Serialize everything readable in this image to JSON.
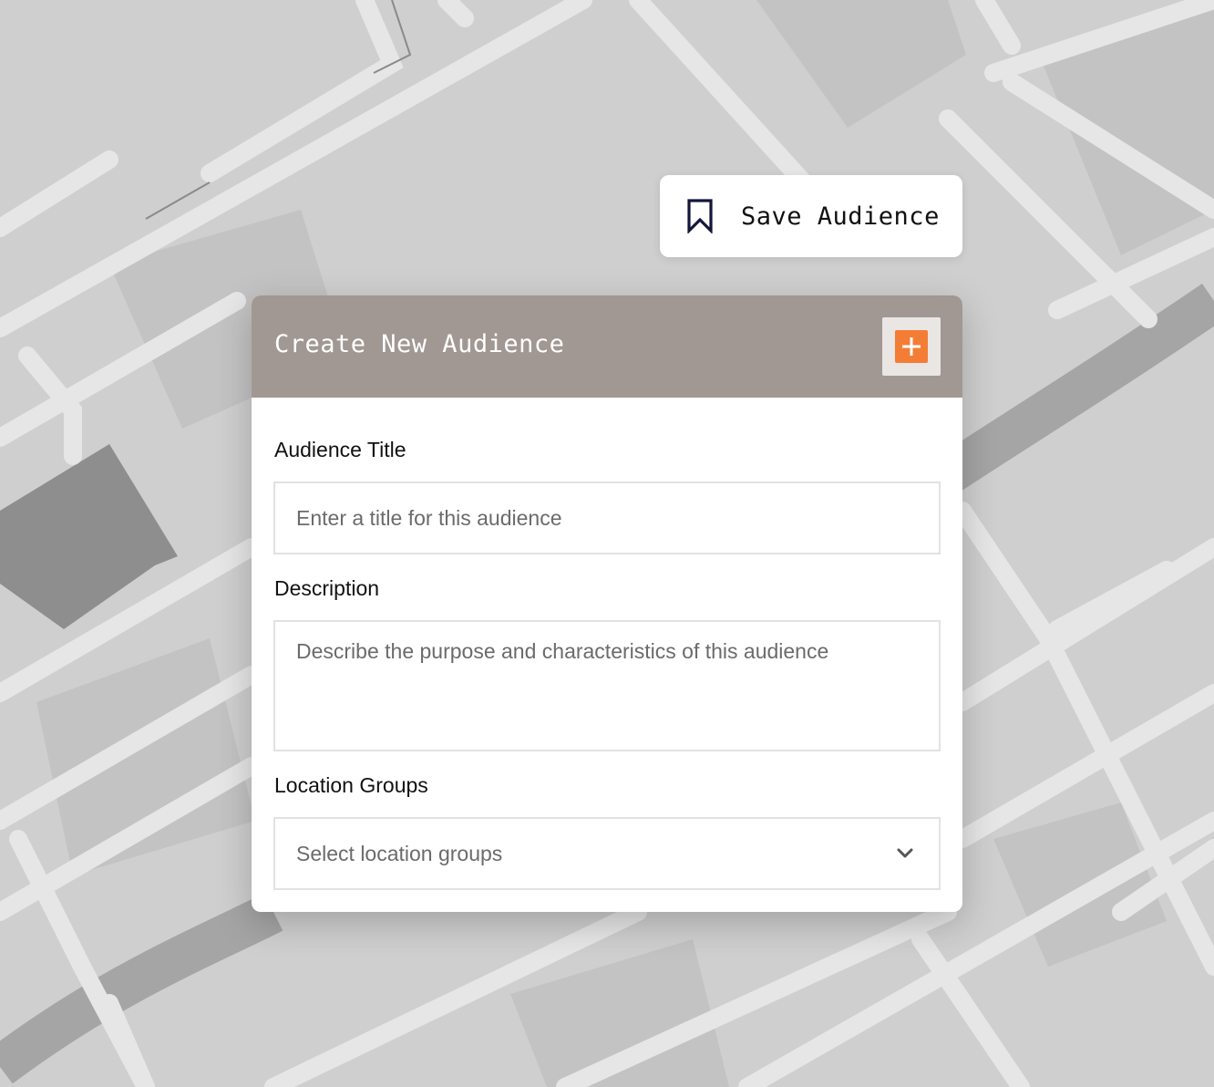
{
  "save_button": {
    "label": "Save Audience",
    "icon": "bookmark-icon"
  },
  "form": {
    "title": "Create New Audience",
    "add_icon": "plus-icon",
    "fields": {
      "audience_title": {
        "label": "Audience Title",
        "placeholder": "Enter a title for this audience"
      },
      "description": {
        "label": "Description",
        "placeholder": "Describe the purpose and characteristics of this audience"
      },
      "location_groups": {
        "label": "Location Groups",
        "placeholder": "Select location groups",
        "icon": "chevron-down-icon"
      }
    }
  },
  "colors": {
    "header_bg": "#a19893",
    "accent": "#f47d36",
    "bookmark_stroke": "#14163a",
    "map_bg": "#cfcfcf"
  }
}
